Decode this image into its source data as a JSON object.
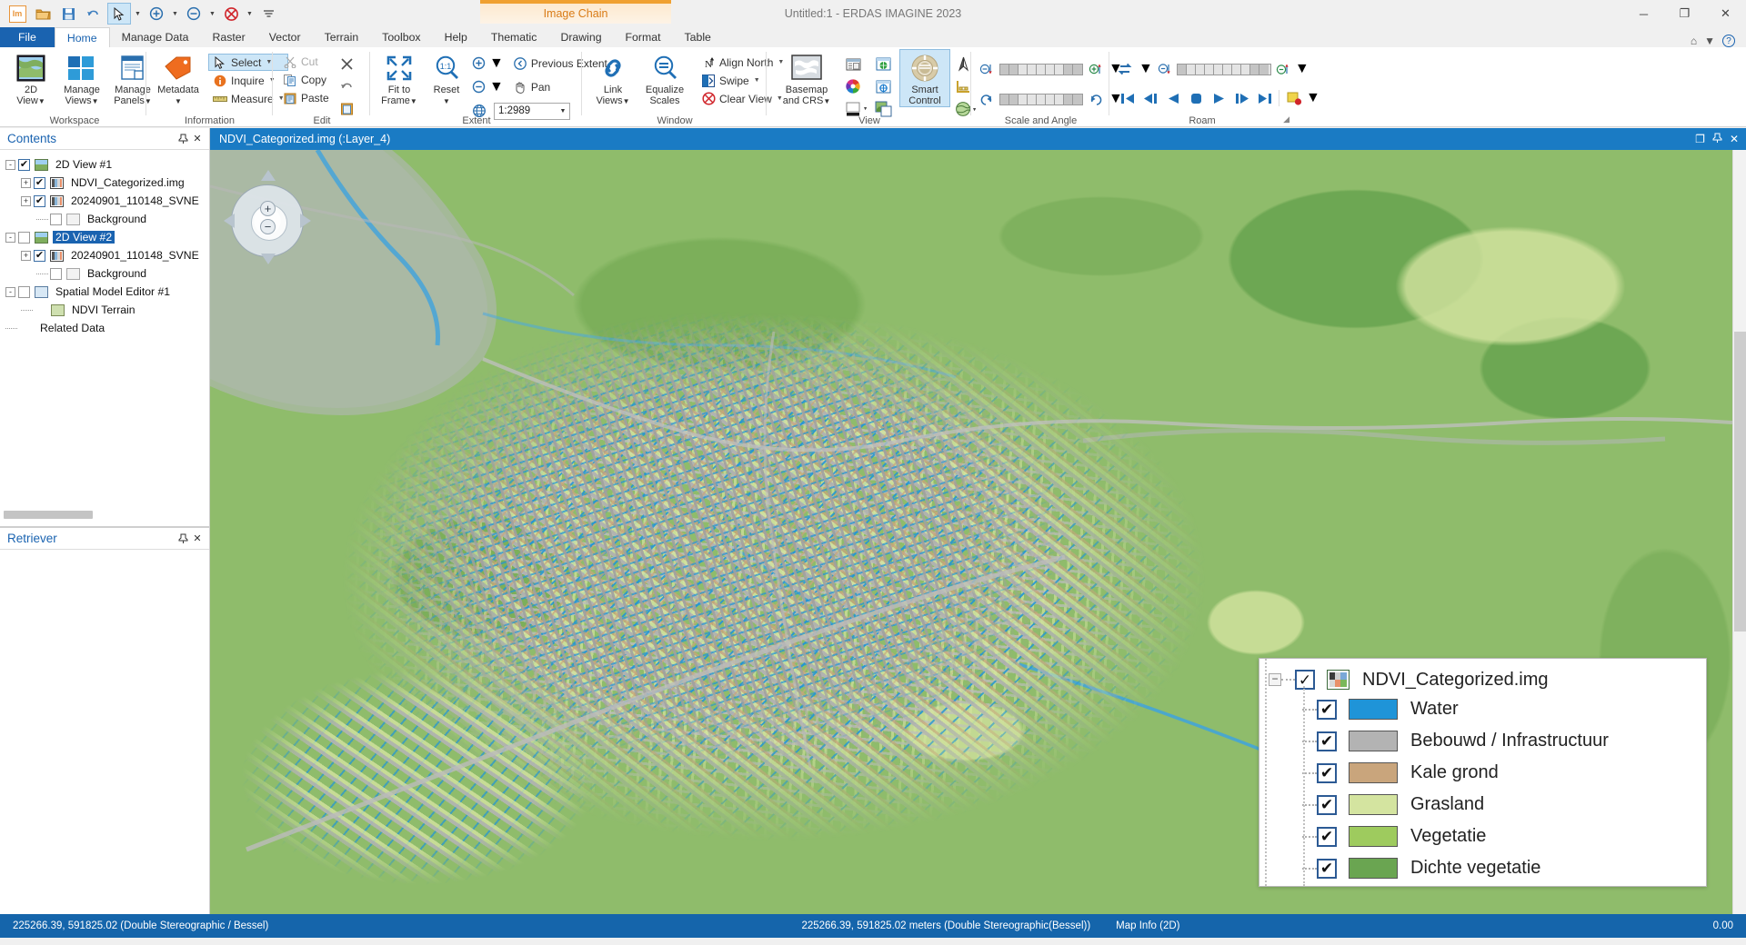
{
  "window": {
    "title": "Untitled:1 - ERDAS IMAGINE 2023",
    "image_chain_tab": "Image Chain",
    "minimize": "─",
    "restore": "❐",
    "close": "✕",
    "help_icon": "?",
    "home_icon": "⌂"
  },
  "quick_access": [
    {
      "name": "imagine-logo",
      "glyph": "Im"
    },
    {
      "name": "open-icon",
      "glyph": "📂"
    },
    {
      "name": "save-icon",
      "glyph": "💾"
    },
    {
      "name": "undo-icon",
      "glyph": "↶"
    },
    {
      "name": "select-arrow-icon",
      "glyph": "➤"
    },
    {
      "name": "zoom-in-icon",
      "glyph": "⊕"
    },
    {
      "name": "zoom-out-icon",
      "glyph": "⊖"
    },
    {
      "name": "clear-view-icon",
      "glyph": "⊗"
    },
    {
      "name": "customize-qat-icon",
      "glyph": "≡"
    }
  ],
  "ribbon_tabs": [
    {
      "label": "File",
      "active": false,
      "file": true
    },
    {
      "label": "Home",
      "active": true
    },
    {
      "label": "Manage Data",
      "active": false
    },
    {
      "label": "Raster",
      "active": false
    },
    {
      "label": "Vector",
      "active": false
    },
    {
      "label": "Terrain",
      "active": false
    },
    {
      "label": "Toolbox",
      "active": false
    },
    {
      "label": "Help",
      "active": false
    },
    {
      "label": "Thematic",
      "active": false
    },
    {
      "label": "Drawing",
      "active": false
    },
    {
      "label": "Format",
      "active": false
    },
    {
      "label": "Table",
      "active": false
    }
  ],
  "ribbon": {
    "workspace": {
      "label": "Workspace",
      "buttons": [
        {
          "label_line1": "2D",
          "label_line2": "View",
          "caret": true,
          "name": "2d-view-button"
        },
        {
          "label_line1": "Manage",
          "label_line2": "Views",
          "caret": true,
          "name": "manage-views-button"
        },
        {
          "label_line1": "Manage",
          "label_line2": "Panels",
          "caret": true,
          "name": "manage-panels-button"
        }
      ]
    },
    "information": {
      "label": "Information",
      "metadata": {
        "label_line1": "Metadata",
        "label_line2": "",
        "caret": true
      },
      "items": [
        {
          "label": "Select",
          "caret": true,
          "selected": true,
          "name": "select-tool"
        },
        {
          "label": "Inquire",
          "caret": true,
          "selected": false,
          "name": "inquire-tool"
        },
        {
          "label": "Measure",
          "caret": true,
          "selected": false,
          "name": "measure-tool"
        }
      ]
    },
    "edit": {
      "label": "Edit",
      "items": [
        {
          "label": "Cut",
          "disabled": true,
          "name": "cut-button"
        },
        {
          "label": "Copy",
          "disabled": false,
          "name": "copy-button"
        },
        {
          "label": "Paste",
          "disabled": false,
          "name": "paste-button"
        }
      ],
      "side_icons": [
        "delete-icon",
        "undo-icon",
        "paste-special-icon"
      ]
    },
    "extent": {
      "label": "Extent",
      "fit_to_frame": {
        "line1": "Fit to",
        "line2": "Frame",
        "caret": true
      },
      "reset": {
        "line1": "Reset",
        "line2": "",
        "caret": true
      },
      "previous_extent": "Previous Extent",
      "pan": "Pan",
      "scale_value": "1:2989"
    },
    "window": {
      "label": "Window",
      "link_views": {
        "line1": "Link",
        "line2": "Views",
        "caret": true
      },
      "equalize_scales": {
        "line1": "Equalize",
        "line2": "Scales",
        "caret": false
      },
      "align_north": "Align North",
      "swipe": "Swipe",
      "clear_view": "Clear View"
    },
    "view": {
      "label": "View",
      "basemap": {
        "line1": "Basemap",
        "line2": "and CRS",
        "caret": true
      },
      "smart_control": {
        "line1": "Smart",
        "line2": "Control",
        "selected": true
      },
      "small_icons": [
        "layer-info-icon",
        "color-wheel-icon",
        "background-color-icon",
        "globe-window-icon",
        "crosshair-window-icon",
        "image-overlay-icon",
        "north-arrow-icon",
        "scale-bar-icon",
        "legend-globe-icon"
      ]
    },
    "scale_and_angle": {
      "label": "Scale and Angle",
      "controls": [
        "zoom-out-step-icon",
        "rotate-ccw-icon",
        "zoom-in-step-icon",
        "rotate-cw-icon"
      ]
    },
    "roam": {
      "label": "Roam",
      "controls": [
        "roam-path-icon",
        "roam-speed-down-icon",
        "roam-speed-up-icon",
        "first-frame-icon",
        "step-back-icon",
        "play-back-icon",
        "stop-icon",
        "play-forward-icon",
        "step-forward-icon",
        "last-frame-icon",
        "record-icon"
      ]
    }
  },
  "contents_panel": {
    "title": "Contents",
    "pin_icon": "📌",
    "close_icon": "✕",
    "tree": [
      {
        "label": "2D View #1",
        "level": 0,
        "checked": true,
        "expander": "-",
        "icon": "view",
        "selected": false
      },
      {
        "label": "NDVI_Categorized.img",
        "level": 1,
        "checked": true,
        "expander": "+",
        "icon": "ras",
        "selected": false
      },
      {
        "label": "20240901_110148_SVNE",
        "level": 1,
        "checked": true,
        "expander": "+",
        "icon": "ras",
        "selected": false
      },
      {
        "label": "Background",
        "level": 2,
        "checked": false,
        "expander": "",
        "icon": "blank",
        "selected": false
      },
      {
        "label": "2D View #2",
        "level": 0,
        "checked": false,
        "expander": "-",
        "icon": "view",
        "selected": true
      },
      {
        "label": "20240901_110148_SVNE",
        "level": 1,
        "checked": true,
        "expander": "+",
        "icon": "ras",
        "selected": false
      },
      {
        "label": "Background",
        "level": 2,
        "checked": false,
        "expander": "",
        "icon": "blank",
        "selected": false
      },
      {
        "label": "Spatial Model Editor #1",
        "level": 0,
        "checked": false,
        "expander": "-",
        "icon": "model",
        "selected": false
      },
      {
        "label": "NDVI Terrain",
        "level": 1,
        "checked": false,
        "expander": "",
        "icon": "terr",
        "selected": false
      },
      {
        "label": "Related Data",
        "level": 0,
        "checked": false,
        "expander": "",
        "icon": "blank",
        "selected": false
      }
    ]
  },
  "retriever_panel": {
    "title": "Retriever",
    "pin_icon": "📌",
    "close_icon": "✕"
  },
  "view_window": {
    "title": "NDVI_Categorized.img (:Layer_4)",
    "restore_icon": "❐",
    "pin_icon": "📌",
    "close_icon": "✕"
  },
  "navigator": {
    "zoom_in": "+",
    "zoom_out": "−"
  },
  "legend": {
    "title": "NDVI_Categorized.img",
    "expander": "−",
    "checked": true,
    "items": [
      {
        "label": "Water",
        "color": "#1f94d8",
        "checked": true
      },
      {
        "label": "Bebouwd / Infrastructuur",
        "color": "#b3b3b3",
        "checked": true
      },
      {
        "label": "Kale grond",
        "color": "#c9a57c",
        "checked": true
      },
      {
        "label": "Grasland",
        "color": "#d4e4a0",
        "checked": true
      },
      {
        "label": "Vegetatie",
        "color": "#9ecb5e",
        "checked": true
      },
      {
        "label": "Dichte vegetatie",
        "color": "#6aa551",
        "checked": true
      }
    ]
  },
  "status_bar": {
    "left": "225266.39, 591825.02  (Double Stereographic / Bessel)",
    "center": "225266.39, 591825.02 meters (Double Stereographic(Bessel))",
    "map_info": "Map Info (2D)",
    "right": "0.00"
  },
  "colors": {
    "accent": "#1a63b0",
    "status_bar": "#1565ab",
    "view_title": "#1a7bc4",
    "image_chain": "#f0a030"
  }
}
